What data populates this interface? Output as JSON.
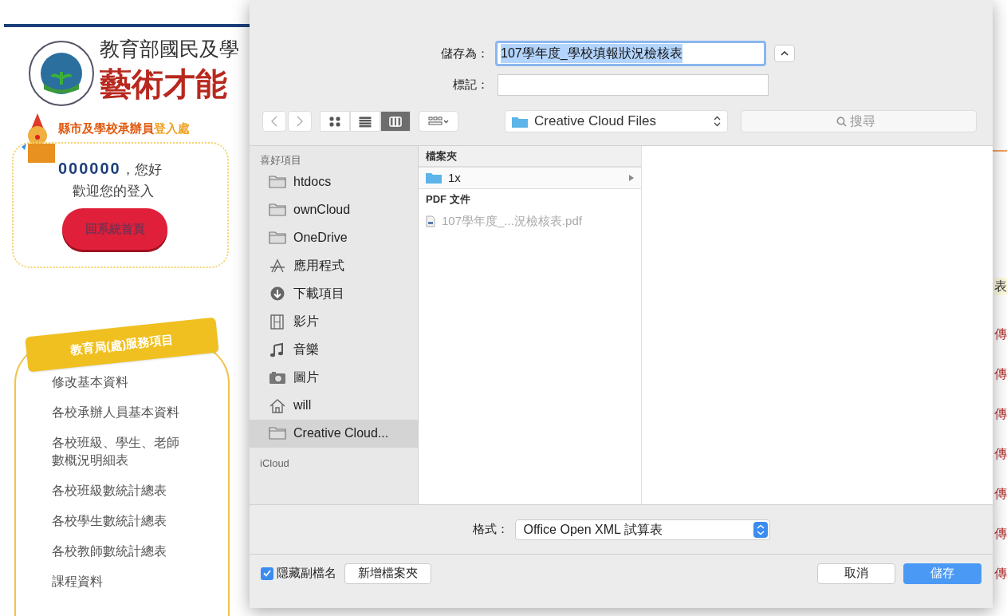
{
  "site": {
    "title_line1": "教育部國民及學",
    "title_line2": "藝術才能",
    "login_heading": "縣市及學校承辦員",
    "login_heading_suffix": "登入處",
    "user_id": "000000",
    "greeting": "，您好",
    "welcome": "歡迎您的登入",
    "home_button": "回系統首頁",
    "menu_ribbon": "教育局(處)服務項目",
    "menu_items": [
      "修改基本資料",
      "各校承辦人員基本資料",
      "各校班級、學生、老師數概況明細表",
      "各校班級數統計總表",
      "各校學生數統計總表",
      "各校教師數統計總表",
      "課程資料"
    ],
    "edge_fragments": [
      {
        "text": "表",
        "kind": "heading"
      },
      {
        "text": "傳",
        "kind": "link"
      },
      {
        "text": "傳",
        "kind": "link"
      },
      {
        "text": "傳",
        "kind": "link"
      },
      {
        "text": "傳",
        "kind": "link"
      },
      {
        "text": "傳",
        "kind": "link"
      },
      {
        "text": "傳",
        "kind": "link"
      },
      {
        "text": "傳",
        "kind": "link"
      }
    ]
  },
  "dialog": {
    "save_as_label": "儲存為：",
    "save_as_value": "107學年度_學校填報狀況檢核表",
    "tags_label": "標記：",
    "toolbar": {
      "view_modes": [
        {
          "kind": "icons",
          "selected": false
        },
        {
          "kind": "list",
          "selected": false
        },
        {
          "kind": "columns",
          "selected": true
        }
      ],
      "location": "Creative Cloud Files",
      "search_placeholder": "搜尋"
    },
    "sidebar": [
      {
        "title": "喜好項目",
        "items": [
          {
            "label": "htdocs",
            "kind": "folder",
            "selected": false
          },
          {
            "label": "ownCloud",
            "kind": "folder",
            "selected": false
          },
          {
            "label": "OneDrive",
            "kind": "folder",
            "selected": false
          },
          {
            "label": "應用程式",
            "kind": "apps",
            "selected": false
          },
          {
            "label": "下載項目",
            "kind": "download",
            "selected": false
          },
          {
            "label": "影片",
            "kind": "film",
            "selected": false
          },
          {
            "label": "音樂",
            "kind": "music",
            "selected": false
          },
          {
            "label": "圖片",
            "kind": "camera",
            "selected": false
          },
          {
            "label": "will",
            "kind": "home",
            "selected": false
          },
          {
            "label": "Creative Cloud...",
            "kind": "folder",
            "selected": true
          }
        ]
      },
      {
        "title": "iCloud"
      }
    ],
    "column": [
      {
        "title": "檔案夾",
        "items": [
          {
            "name": "1x",
            "kind": "folder",
            "selected": true,
            "disabled": false
          }
        ]
      },
      {
        "title": "PDF 文件",
        "items": [
          {
            "name": "107學年度_...況檢核表.pdf",
            "kind": "pdf",
            "selected": false,
            "disabled": true
          }
        ]
      }
    ],
    "format_label": "格式：",
    "format_value": "Office Open XML 試算表",
    "hide_extension": {
      "label": "隱藏副檔名",
      "checked": true
    },
    "new_folder_button": "新增檔案夾",
    "cancel_button": "取消",
    "save_button": "儲存"
  }
}
